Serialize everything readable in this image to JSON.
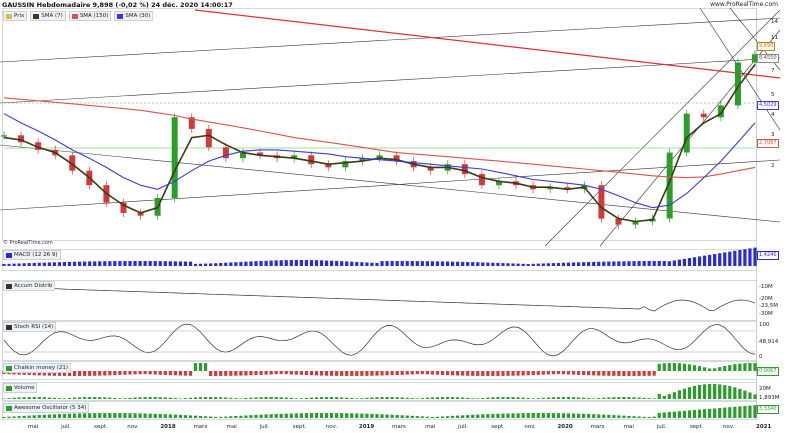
{
  "header": {
    "title": "GAUSSIN Hebdomadaire 9,898 (-0,02 %) 24 déc. 2020 14:00:17",
    "site": "www.ProRealTime.com",
    "source": "© ProRealTime.com"
  },
  "legend": [
    {
      "label": "Prix",
      "color": "#d8c14a"
    },
    {
      "label": "SMA (7)",
      "color": "#3a3a1a"
    },
    {
      "label": "SMA (150)",
      "color": "#d9534f"
    },
    {
      "label": "SMA (30)",
      "color": "#3b3bd6"
    }
  ],
  "colors": {
    "up": "#2a9d2a",
    "down": "#d13a3a",
    "sma7": "#3a3a14",
    "sma150": "#d9534f",
    "sma30": "#3b3bd6",
    "macd": "#2a2ad8",
    "accum": "#333333",
    "rsi": "#333333",
    "chaikin_pos": "#2a9d2a",
    "chaikin_neg": "#d13a3a",
    "volume": "#2a9d2a",
    "ao": "#2a9d2a"
  },
  "price_axis": {
    "ticks": [
      "14",
      "11",
      "9",
      "7",
      "5",
      "4",
      "3",
      "2"
    ],
    "labels": [
      {
        "text": "9,898",
        "color": "#b8860b"
      },
      {
        "text": "8,4550",
        "color": "#555555"
      },
      {
        "text": "4,5029",
        "color": "#3b3bd6"
      },
      {
        "text": "2,7087",
        "color": "#d9534f"
      }
    ]
  },
  "panes": {
    "macd": {
      "label": "MACD (12 26 9)",
      "value": "1,4240"
    },
    "accum": {
      "label": "Accum Distrib",
      "ticks": [
        "-10M",
        "-20M",
        "-23,5M",
        "-30M"
      ]
    },
    "rsi": {
      "label": "Stoch RSI (14)",
      "ticks": [
        "100",
        "48,914",
        "0"
      ]
    },
    "chaikin": {
      "label": "Chaikin money (21)",
      "value": "0,0067"
    },
    "volume": {
      "label": "Volume",
      "ticks": [
        "20M",
        "1,893M"
      ]
    },
    "ao": {
      "label": "Awesome Oscillator (5 34)",
      "value": "3,3340"
    }
  },
  "x_axis": [
    {
      "label": "mai",
      "bold": false
    },
    {
      "label": "juil.",
      "bold": false
    },
    {
      "label": "sept.",
      "bold": false
    },
    {
      "label": "nov.",
      "bold": false
    },
    {
      "label": "2018",
      "bold": true
    },
    {
      "label": "mars",
      "bold": false
    },
    {
      "label": "mai",
      "bold": false
    },
    {
      "label": "juil.",
      "bold": false
    },
    {
      "label": "sept.",
      "bold": false
    },
    {
      "label": "nov.",
      "bold": false
    },
    {
      "label": "2019",
      "bold": true
    },
    {
      "label": "mars",
      "bold": false
    },
    {
      "label": "mai",
      "bold": false
    },
    {
      "label": "juil.",
      "bold": false
    },
    {
      "label": "sept.",
      "bold": false
    },
    {
      "label": "nov.",
      "bold": false
    },
    {
      "label": "2020",
      "bold": true
    },
    {
      "label": "mars",
      "bold": false
    },
    {
      "label": "mai",
      "bold": false
    },
    {
      "label": "juil.",
      "bold": false
    },
    {
      "label": "sept.",
      "bold": false
    },
    {
      "label": "nov.",
      "bold": false
    },
    {
      "label": "2021",
      "bold": true
    }
  ],
  "chart_data": {
    "type": "line",
    "title": "GAUSSIN Hebdomadaire 9,898 (-0,02 %) 24 déc. 2020 14:00:17",
    "log_scale": true,
    "ylim": [
      1.2,
      15
    ],
    "x": [
      "2017-04",
      "2017-05",
      "2017-06",
      "2017-07",
      "2017-08",
      "2017-09",
      "2017-10",
      "2017-11",
      "2017-12",
      "2018-01",
      "2018-02",
      "2018-03",
      "2018-04",
      "2018-05",
      "2018-06",
      "2018-07",
      "2018-08",
      "2018-09",
      "2018-10",
      "2018-11",
      "2018-12",
      "2019-01",
      "2019-02",
      "2019-03",
      "2019-04",
      "2019-05",
      "2019-06",
      "2019-07",
      "2019-08",
      "2019-09",
      "2019-10",
      "2019-11",
      "2019-12",
      "2020-01",
      "2020-02",
      "2020-03",
      "2020-04",
      "2020-05",
      "2020-06",
      "2020-07",
      "2020-08",
      "2020-09",
      "2020-10",
      "2020-11",
      "2020-12"
    ],
    "series": [
      {
        "name": "Prix",
        "values": [
          3.9,
          3.6,
          3.3,
          3.1,
          2.6,
          2.2,
          1.8,
          1.6,
          1.55,
          1.9,
          4.8,
          4.2,
          3.4,
          3.0,
          3.2,
          3.1,
          3.0,
          3.1,
          2.8,
          2.7,
          2.9,
          3.0,
          3.1,
          2.9,
          2.7,
          2.6,
          2.8,
          2.5,
          2.2,
          2.3,
          2.2,
          2.1,
          2.15,
          2.1,
          2.2,
          1.5,
          1.4,
          1.45,
          1.5,
          3.2,
          5.0,
          4.8,
          5.5,
          9.0,
          9.9
        ]
      },
      {
        "name": "SMA (7)",
        "values": [
          3.8,
          3.7,
          3.4,
          3.2,
          2.8,
          2.4,
          2.0,
          1.75,
          1.6,
          1.7,
          2.6,
          3.8,
          3.9,
          3.5,
          3.2,
          3.1,
          3.05,
          3.0,
          2.9,
          2.8,
          2.85,
          2.9,
          3.0,
          2.95,
          2.8,
          2.7,
          2.7,
          2.6,
          2.4,
          2.3,
          2.25,
          2.15,
          2.15,
          2.1,
          2.15,
          1.7,
          1.5,
          1.45,
          1.48,
          2.3,
          3.8,
          4.5,
          5.0,
          6.8,
          8.8
        ]
      },
      {
        "name": "SMA (150)",
        "values": [
          6.0,
          5.9,
          5.8,
          5.7,
          5.6,
          5.5,
          5.4,
          5.3,
          5.2,
          5.05,
          4.9,
          4.7,
          4.55,
          4.4,
          4.25,
          4.1,
          3.95,
          3.8,
          3.7,
          3.6,
          3.5,
          3.4,
          3.3,
          3.2,
          3.15,
          3.1,
          3.05,
          3.0,
          2.95,
          2.9,
          2.85,
          2.8,
          2.75,
          2.7,
          2.65,
          2.6,
          2.55,
          2.5,
          2.45,
          2.42,
          2.4,
          2.42,
          2.5,
          2.6,
          2.7
        ]
      },
      {
        "name": "SMA (30)",
        "values": [
          5.0,
          4.5,
          4.1,
          3.7,
          3.3,
          3.0,
          2.7,
          2.4,
          2.2,
          2.1,
          2.3,
          2.6,
          2.9,
          3.1,
          3.25,
          3.3,
          3.3,
          3.25,
          3.2,
          3.15,
          3.05,
          3.0,
          2.95,
          2.9,
          2.85,
          2.8,
          2.75,
          2.7,
          2.65,
          2.55,
          2.45,
          2.35,
          2.3,
          2.25,
          2.2,
          2.1,
          1.95,
          1.8,
          1.7,
          1.75,
          2.0,
          2.4,
          2.9,
          3.6,
          4.5
        ]
      }
    ]
  }
}
